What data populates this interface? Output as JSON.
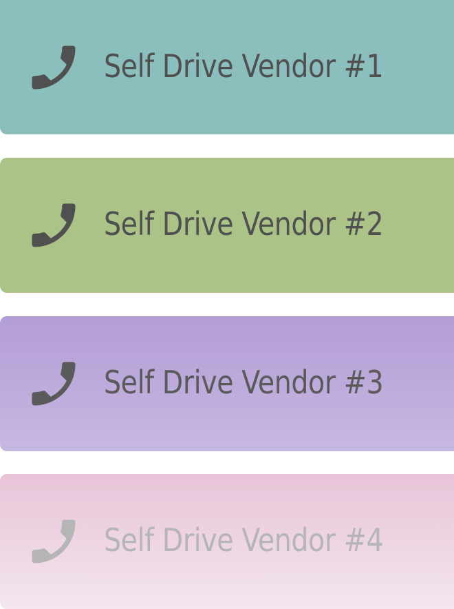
{
  "vendors": [
    {
      "label": "Self Drive Vendor #1",
      "icon": "phone-icon",
      "background": "#8bbfbd",
      "text_color": "#505050"
    },
    {
      "label": "Self Drive Vendor #2",
      "icon": "phone-icon",
      "background": "#acc387",
      "text_color": "#505050"
    },
    {
      "label": "Self Drive Vendor #3",
      "icon": "phone-icon",
      "background_gradient": [
        "#b39dd6",
        "#c7b8e1"
      ],
      "text_color": "#5a5a5a"
    },
    {
      "label": "Self Drive Vendor #4",
      "icon": "phone-icon",
      "background_gradient": [
        "#e8c4d8",
        "#f3e6ee"
      ],
      "text_color": "#b5b5b5"
    }
  ]
}
